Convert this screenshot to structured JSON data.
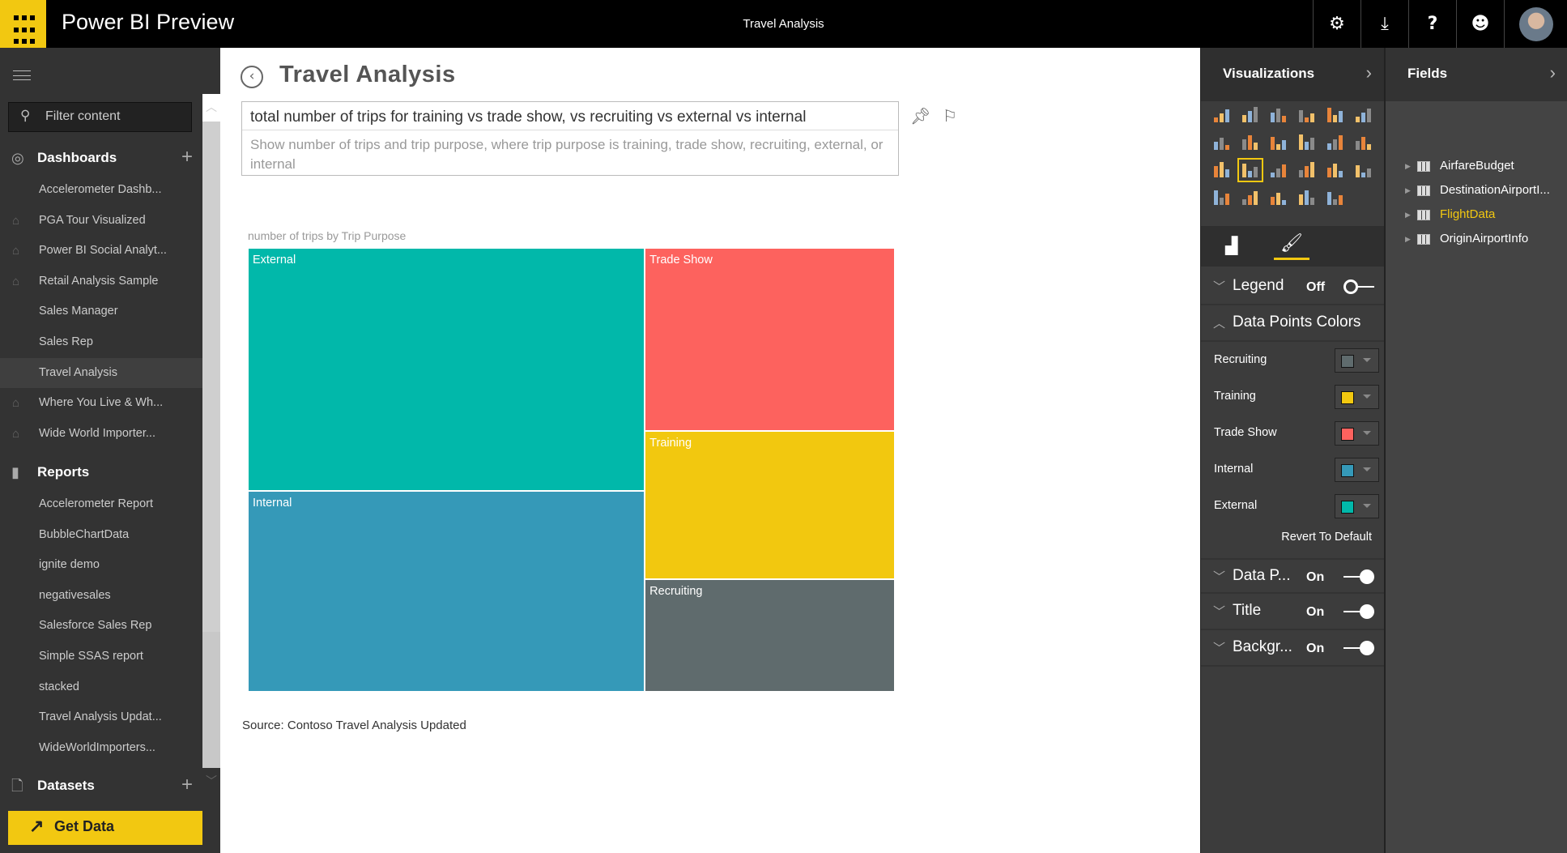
{
  "topbar": {
    "app_name": "Power BI Preview",
    "report_title": "Travel Analysis",
    "icons": [
      "settings-icon",
      "download-icon",
      "help-icon",
      "smiley-icon",
      "avatar"
    ]
  },
  "nav": {
    "filter_placeholder": "Filter content",
    "dashboards": {
      "title": "Dashboards",
      "items": [
        {
          "label": "Accelerometer Dashb...",
          "shared": false
        },
        {
          "label": "PGA Tour Visualized",
          "shared": true
        },
        {
          "label": "Power BI Social Analyt...",
          "shared": true
        },
        {
          "label": "Retail Analysis Sample",
          "shared": true
        },
        {
          "label": "Sales Manager",
          "shared": false
        },
        {
          "label": "Sales Rep",
          "shared": false
        },
        {
          "label": "Travel Analysis",
          "shared": false,
          "selected": true
        },
        {
          "label": "Where You Live & Wh...",
          "shared": true
        },
        {
          "label": "Wide World Importer...",
          "shared": true
        }
      ]
    },
    "reports": {
      "title": "Reports",
      "items": [
        "Accelerometer Report",
        "BubbleChartData",
        "ignite demo",
        "negativesales",
        "Salesforce Sales Rep",
        "Simple SSAS report",
        "stacked",
        "Travel Analysis Updat...",
        "WideWorldImporters..."
      ]
    },
    "datasets": {
      "title": "Datasets"
    },
    "get_data": "Get Data"
  },
  "main": {
    "title": "Travel Analysis",
    "question": "total number of trips for training vs trade show, vs recruiting vs external vs internal",
    "restatement": "Show number of trips and trip purpose, where trip purpose is training, trade show, recruiting, external, or internal",
    "chart_title": "number of trips by Trip Purpose",
    "source": "Source: Contoso Travel Analysis Updated"
  },
  "chart_data": {
    "type": "treemap",
    "title": "number of trips by Trip Purpose",
    "categories": [
      "External",
      "Internal",
      "Trade Show",
      "Training",
      "Recruiting"
    ],
    "colors": {
      "External": "#01b8aa",
      "Internal": "#3599b8",
      "Trade Show": "#fd625e",
      "Training": "#f2c80f",
      "Recruiting": "#5f6b6d"
    }
  },
  "visualizations": {
    "title": "Visualizations",
    "selected": "treemap",
    "sections": {
      "legend": {
        "label": "Legend",
        "state": "Off"
      },
      "data_points_colors": {
        "label": "Data Points Colors"
      },
      "data_labels": {
        "label": "Data P...",
        "state": "On"
      },
      "title": {
        "label": "Title",
        "state": "On"
      },
      "background": {
        "label": "Backgr...",
        "state": "On"
      }
    },
    "colors": [
      {
        "label": "Recruiting",
        "color": "#5f6b6d"
      },
      {
        "label": "Training",
        "color": "#f2c80f"
      },
      {
        "label": "Trade Show",
        "color": "#fd625e"
      },
      {
        "label": "Internal",
        "color": "#3599b8"
      },
      {
        "label": "External",
        "color": "#01b8aa"
      }
    ],
    "revert": "Revert To Default"
  },
  "fields": {
    "title": "Fields",
    "items": [
      {
        "label": "AirfareBudget"
      },
      {
        "label": "DestinationAirportI..."
      },
      {
        "label": "FlightData",
        "highlight": true
      },
      {
        "label": "OriginAirportInfo"
      }
    ]
  },
  "accent": "#f2c811"
}
